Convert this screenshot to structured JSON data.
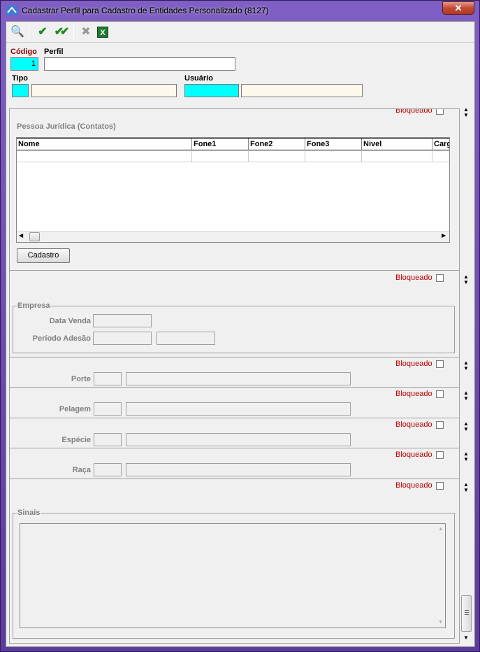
{
  "window": {
    "title": "Cadastrar Perfil para Cadastro de Entidades Personalizado (8127)",
    "close_label": "✕"
  },
  "toolbar": {
    "search": "🔍",
    "confirm": "✔",
    "confirm_all": "✔✔",
    "cancel": "✖",
    "excel": "X"
  },
  "header": {
    "codigo_label": "Código",
    "codigo_value": "1",
    "perfil_label": "Perfil",
    "perfil_value": "",
    "tipo_label": "Tipo",
    "usuario_label": "Usuário"
  },
  "sections": {
    "bloqueado": "Bloqueado",
    "pj_title": "Pessoa Jurídica (Contatos)",
    "grid_columns": [
      "Nome",
      "Fone1",
      "Fone2",
      "Fone3",
      "Nivel",
      "Carg"
    ],
    "cadastro_button": "Cadastro",
    "empresa_title": "Empresa",
    "data_venda": "Data Venda",
    "periodo_adesao": "Período Adesão",
    "porte": "Porte",
    "pelagem": "Pelagem",
    "especie": "Espécie",
    "raca": "Raça",
    "sinais": "Sinais"
  },
  "colors": {
    "accent_cyan": "#00ffff",
    "bloqueado_red": "#c00000",
    "codigo_red": "#8b0000"
  }
}
